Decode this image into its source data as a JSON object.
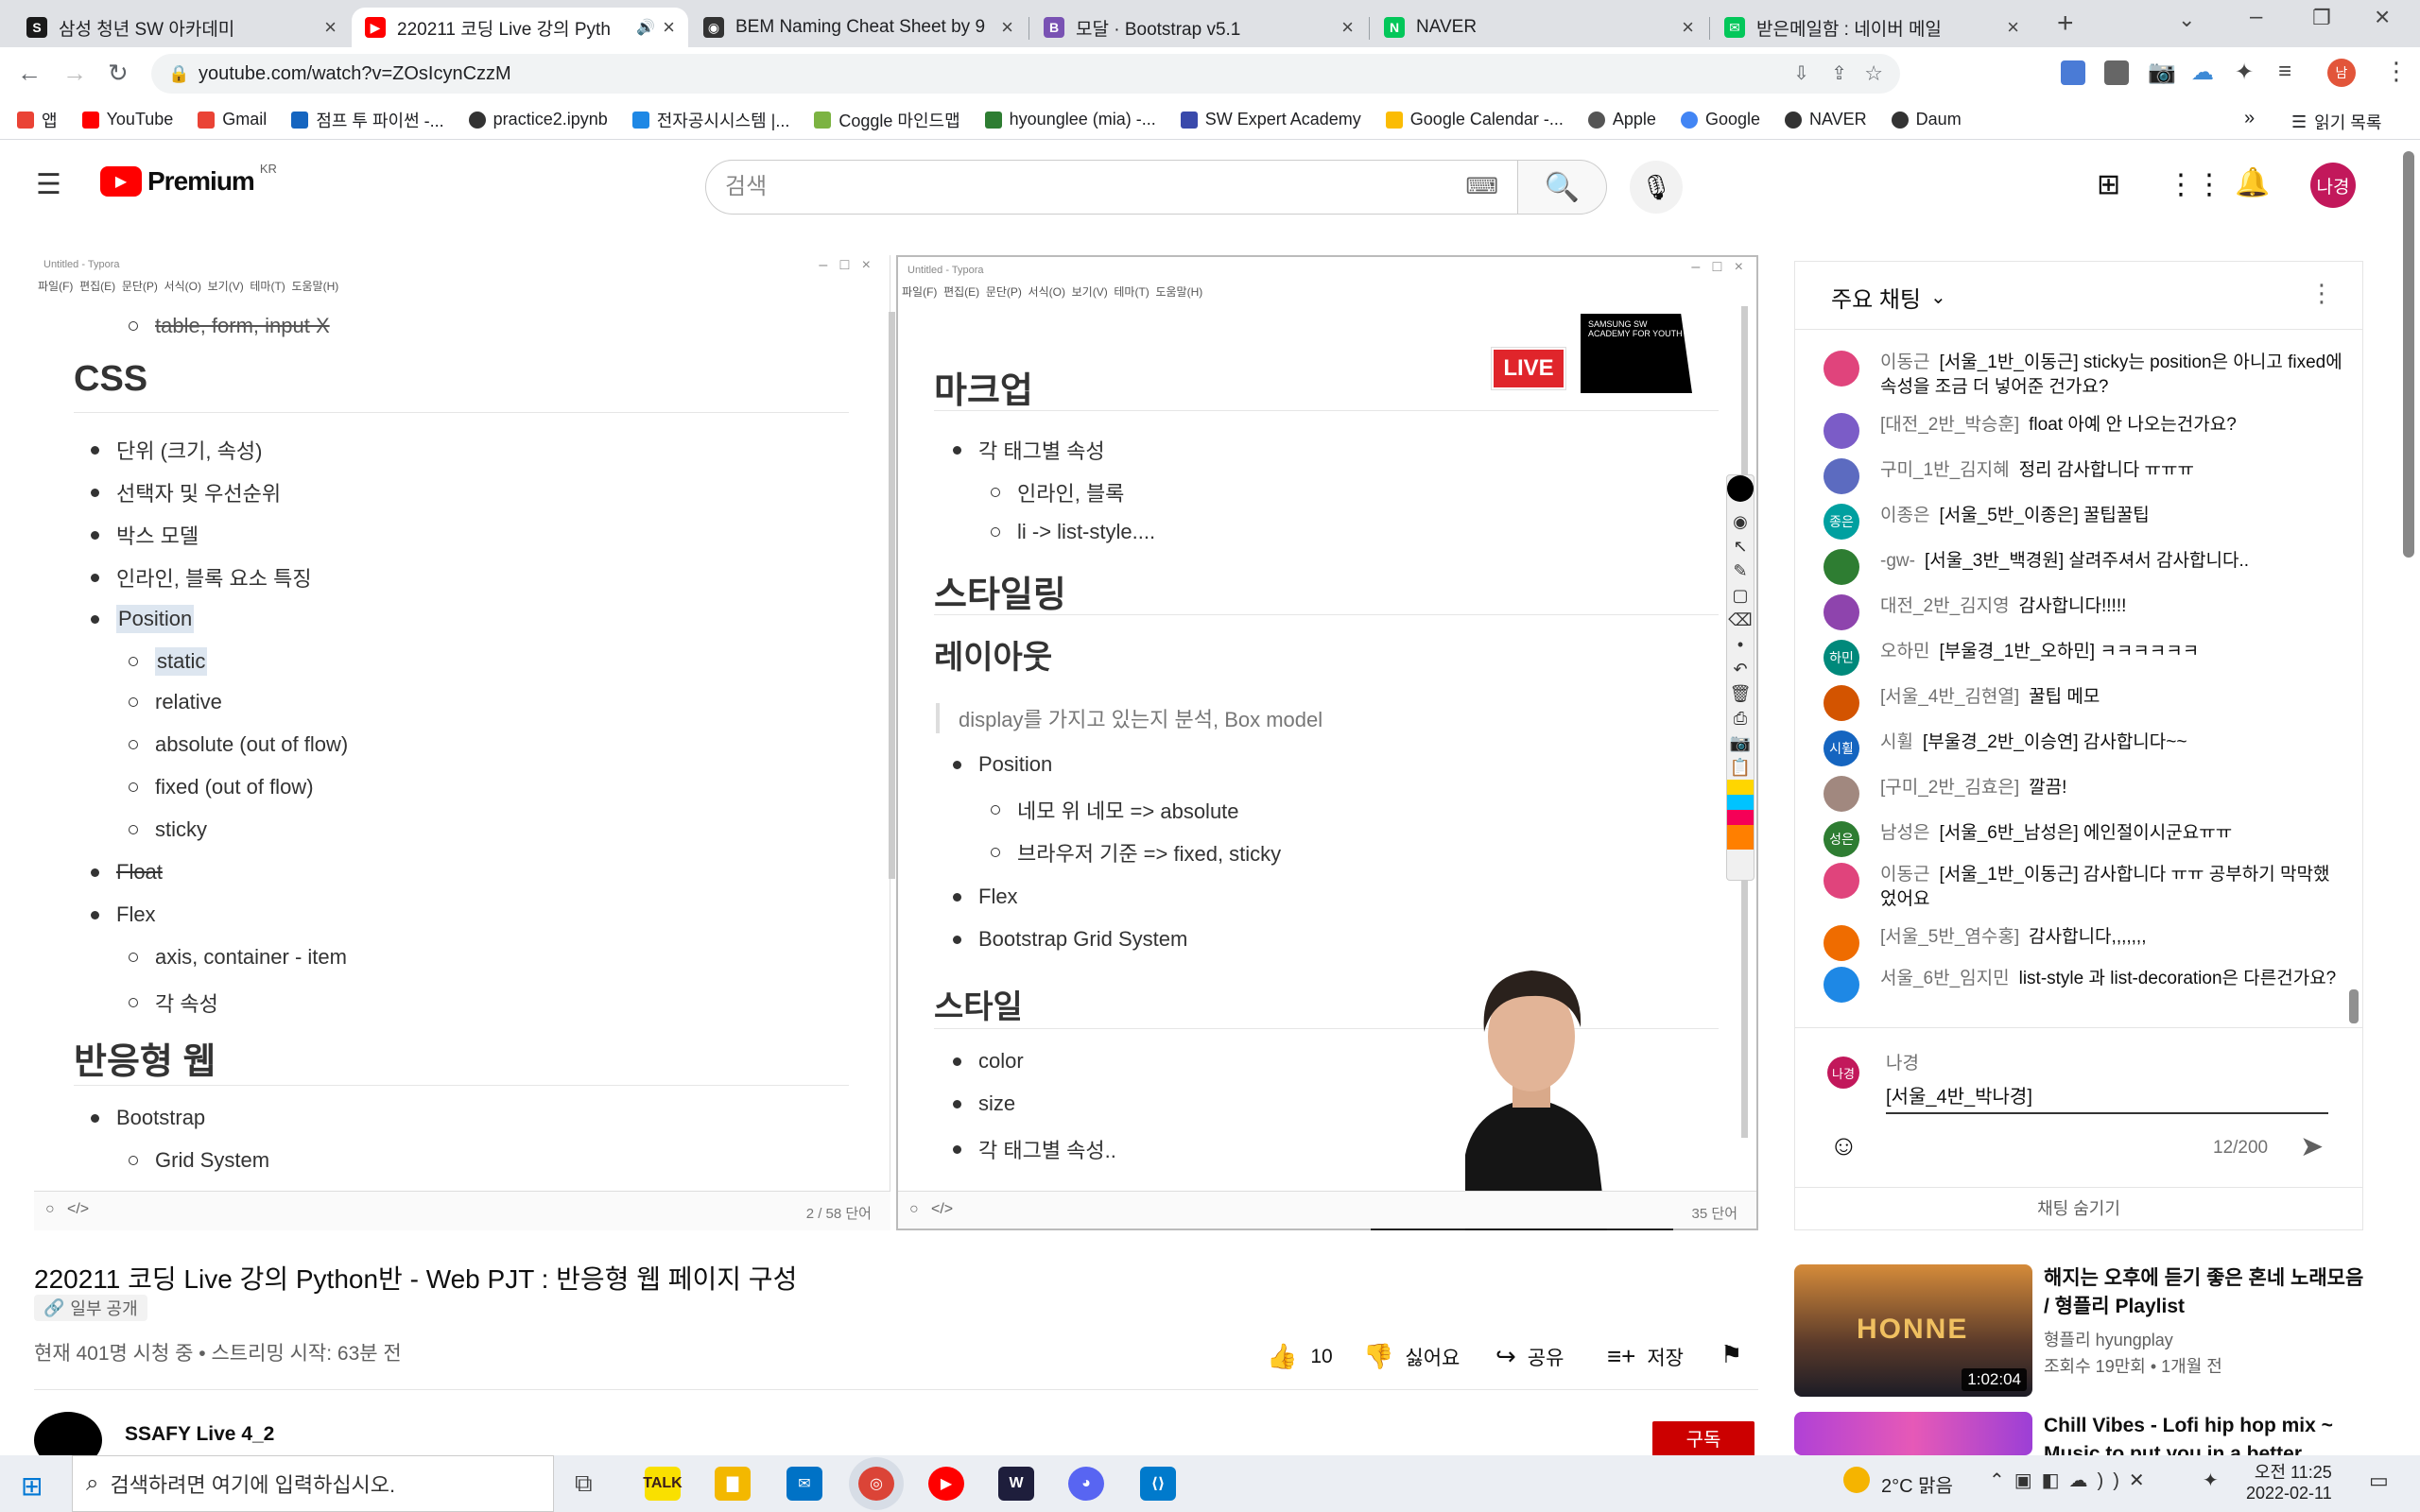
{
  "browser": {
    "tabs": [
      {
        "label": "삼성 청년 SW 아카데미",
        "favicon": "S",
        "color": "#1a1a1a"
      },
      {
        "label": "220211 코딩 Live 강의 Pyth",
        "favicon": "▶",
        "color": "#ff0000",
        "active": true
      },
      {
        "label": "BEM Naming Cheat Sheet by 9",
        "favicon": "◉",
        "color": "#333333"
      },
      {
        "label": "모달 · Bootstrap v5.1",
        "favicon": "B",
        "color": "#7952b3"
      },
      {
        "label": "NAVER",
        "favicon": "N",
        "color": "#03c75a"
      },
      {
        "label": "받은메일함 : 네이버 메일",
        "favicon": "✉",
        "color": "#03c75a"
      }
    ],
    "url": "youtube.com/watch?v=ZOsIcynCzzM",
    "bookmarks": [
      {
        "label": "앱",
        "color": "#ea4335"
      },
      {
        "label": "YouTube",
        "color": "#ff0000"
      },
      {
        "label": "Gmail",
        "color": "#ea4335"
      },
      {
        "label": "점프 투 파이썬 -...",
        "color": "#1565c0"
      },
      {
        "label": "practice2.ipynb",
        "color": "#333333"
      },
      {
        "label": "전자공시시스템 |...",
        "color": "#1e88e5"
      },
      {
        "label": "Coggle 마인드맵",
        "color": "#7cb342"
      },
      {
        "label": "hyounglee (mia) -...",
        "color": "#2e7d32"
      },
      {
        "label": "SW Expert Academy",
        "color": "#3949ab"
      },
      {
        "label": "Google Calendar -...",
        "color": "#fbbc04"
      },
      {
        "label": "Apple",
        "color": "#555555"
      },
      {
        "label": "Google",
        "color": "#4285f4"
      },
      {
        "label": "NAVER",
        "color": "#333333"
      },
      {
        "label": "Daum",
        "color": "#333333"
      }
    ],
    "bookmarks_more": "»",
    "reading_list": "읽기 목록"
  },
  "youtube": {
    "logo": "Premium",
    "region": "KR",
    "search_placeholder": "검색",
    "avatar": "나경"
  },
  "slides": {
    "left_window_title": "Untitled - Typora",
    "left_menu": "파일(F)  편집(E)  문단(P)  서식(O)  보기(V)  테마(T)  도움말(H)",
    "left_items": [
      {
        "text": "table, form, input X",
        "level": 2,
        "strike": true
      },
      {
        "text": "CSS",
        "level": 0
      },
      {
        "text": "단위 (크기, 속성)",
        "level": 1
      },
      {
        "text": "선택자 및 우선순위",
        "level": 1
      },
      {
        "text": "박스 모델",
        "level": 1
      },
      {
        "text": "인라인, 블록 요소 특징",
        "level": 1
      },
      {
        "text": "Position",
        "level": 1,
        "hl": true
      },
      {
        "text": "static",
        "level": 2,
        "hl": true
      },
      {
        "text": "relative",
        "level": 2
      },
      {
        "text": "absolute (out of flow)",
        "level": 2
      },
      {
        "text": "fixed (out of flow)",
        "level": 2
      },
      {
        "text": "sticky",
        "level": 2
      },
      {
        "text": "Float",
        "level": 1,
        "strike": true
      },
      {
        "text": "Flex",
        "level": 1
      },
      {
        "text": "axis, container - item",
        "level": 2
      },
      {
        "text": "각 속성",
        "level": 2
      },
      {
        "text": "반응형 웹",
        "level": 0
      },
      {
        "text": "Bootstrap",
        "level": 1
      },
      {
        "text": "Grid System",
        "level": 2
      }
    ],
    "left_wordcount": "2 / 58 단어",
    "right_window_title": "Untitled - Typora",
    "right_menu": "파일(F)  편집(E)  문단(P)  서식(O)  보기(V)  테마(T)  도움말(H)",
    "right_items": [
      {
        "text": "마크업",
        "level": 0
      },
      {
        "text": "각 태그별 속성",
        "level": 1
      },
      {
        "text": "인라인, 블록",
        "level": 2
      },
      {
        "text": "li -> list-style....",
        "level": 2
      },
      {
        "text": "스타일링",
        "level": 0
      },
      {
        "text": "레이아웃",
        "level": 0
      },
      {
        "text": "display를 가지고 있는지 분석, Box model",
        "level": 9
      },
      {
        "text": "Position",
        "level": 1
      },
      {
        "text": "네모 위 네모 => absolute",
        "level": 2
      },
      {
        "text": "브라우저 기준 => fixed, sticky",
        "level": 2
      },
      {
        "text": "Flex",
        "level": 1
      },
      {
        "text": "Bootstrap Grid System",
        "level": 1
      },
      {
        "text": "스타일",
        "level": 0
      },
      {
        "text": "color",
        "level": 1
      },
      {
        "text": "size",
        "level": 1
      },
      {
        "text": "각 태그별 속성..",
        "level": 1
      }
    ],
    "right_wordcount": "35 단어",
    "live_badge": "LIVE",
    "academy_logo": "SAMSUNG SW ACADEMY FOR YOUTH"
  },
  "video": {
    "title": "220211 코딩 Live 강의 Python반 - Web PJT : 반응형 웹 페이지 구성",
    "visibility": "일부 공개",
    "stats": "현재 401명 시청 중 • 스트리밍 시작: 63분 전",
    "likes": "10",
    "dislike": "싫어요",
    "share": "공유",
    "save": "저장",
    "channel": "SSAFY Live 4_2",
    "subscribe": "구독"
  },
  "chat": {
    "header": "주요 채팅",
    "messages": [
      {
        "author": "이동근",
        "text": "[서울_1반_이동근] sticky는 position은 아니고 fixed에 속성을 조금 더 넣어준 건가요?",
        "color": "#e0447c"
      },
      {
        "author": "[대전_2반_박승훈]",
        "text": "float 아예 안 나오는건가요?",
        "color": "#7b5cc7"
      },
      {
        "author": "구미_1반_김지혜",
        "text": "정리 감사합니다 ㅠㅠㅠ",
        "color": "#5c6bc0"
      },
      {
        "author": "이종은",
        "text": "[서울_5반_이종은] 꿀팁꿀팁",
        "color": "#00a0a0",
        "initials": "종은"
      },
      {
        "author": "-gw-",
        "text": "[서울_3반_백경원] 살려주셔서 감사합니다..",
        "color": "#2e7d32"
      },
      {
        "author": "대전_2반_김지영",
        "text": "감사합니다!!!!!",
        "color": "#8e44ad"
      },
      {
        "author": "오하민",
        "text": "[부울경_1반_오하민] ㅋㅋㅋㅋㅋㅋ",
        "color": "#00897b",
        "initials": "하민"
      },
      {
        "author": "[서울_4반_김현열]",
        "text": "꿀팁 메모",
        "color": "#d35400"
      },
      {
        "author": "시휠",
        "text": "[부울경_2반_이승연] 감사합니다~~",
        "color": "#1565c0",
        "initials": "시휠"
      },
      {
        "author": "[구미_2반_김효은]",
        "text": "깔끔!",
        "color": "#a1887f"
      },
      {
        "author": "남성은",
        "text": "[서울_6반_남성은] 에인절이시군요ㅠㅠ",
        "color": "#2e7d32",
        "initials": "성은"
      },
      {
        "author": "이동근",
        "text": "[서울_1반_이동근] 감사합니다 ㅠㅠ 공부하기 막막했었어요",
        "color": "#e0447c"
      },
      {
        "author": "[서울_5반_염수홍]",
        "text": "감사합니다,,,,,,,",
        "color": "#ef6c00"
      },
      {
        "author": "서울_6반_임지민",
        "text": "list-style 과 list-decoration은 다른건가요?",
        "color": "#1e88e5"
      }
    ],
    "input_name": "나경",
    "input_value": "[서울_4반_박나경]",
    "char_count": "12/200",
    "hide_chat": "채팅 숨기기"
  },
  "related": [
    {
      "title": "해지는 오후에 듣기 좋은 혼네 노래모음 / 형플리 Playlist",
      "channel": "형플리 hyungplay",
      "meta": "조회수 19만회 • 1개월 전",
      "duration": "1:02:04",
      "thumb_text": "HONNE"
    },
    {
      "title": "Chill Vibes - Lofi hip hop mix ~ Music to put you in a better",
      "channel": "",
      "meta": "",
      "duration": "",
      "thumb_text": ""
    }
  ],
  "taskbar": {
    "search_placeholder": "검색하려면 여기에 입력하십시오.",
    "weather": "2°C 맑음",
    "time": "오전 11:25",
    "date": "2022-02-11"
  }
}
